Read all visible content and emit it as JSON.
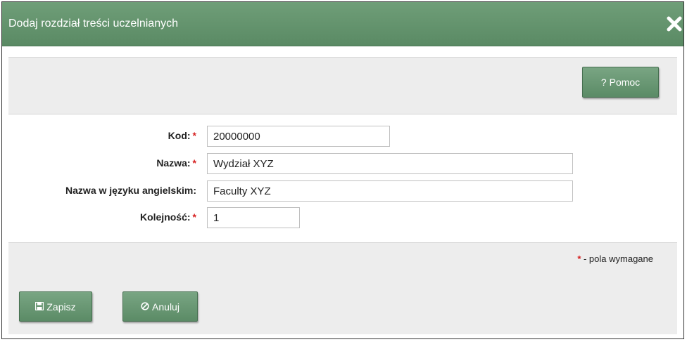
{
  "dialog": {
    "title": "Dodaj rozdział treści uczelnianych",
    "close_icon": "close-icon"
  },
  "toolbar": {
    "help_label": "Pomoc",
    "help_icon": "question-icon"
  },
  "form": {
    "fields": [
      {
        "label": "Kod:",
        "required": true,
        "value": "20000000"
      },
      {
        "label": "Nazwa:",
        "required": true,
        "value": "Wydział XYZ"
      },
      {
        "label": "Nazwa w języku angielskim:",
        "required": false,
        "value": "Faculty XYZ"
      },
      {
        "label": "Kolejność:",
        "required": true,
        "value": "1"
      }
    ],
    "required_marker": "*"
  },
  "required_note": {
    "star": "*",
    "text": " - pola wymagane"
  },
  "footer": {
    "save_label": "Zapisz",
    "save_icon": "floppy-disk-icon",
    "cancel_label": "Anuluj",
    "cancel_icon": "ban-circle-icon"
  },
  "colors": {
    "accent": "#5a8a64",
    "required": "#d62222"
  }
}
